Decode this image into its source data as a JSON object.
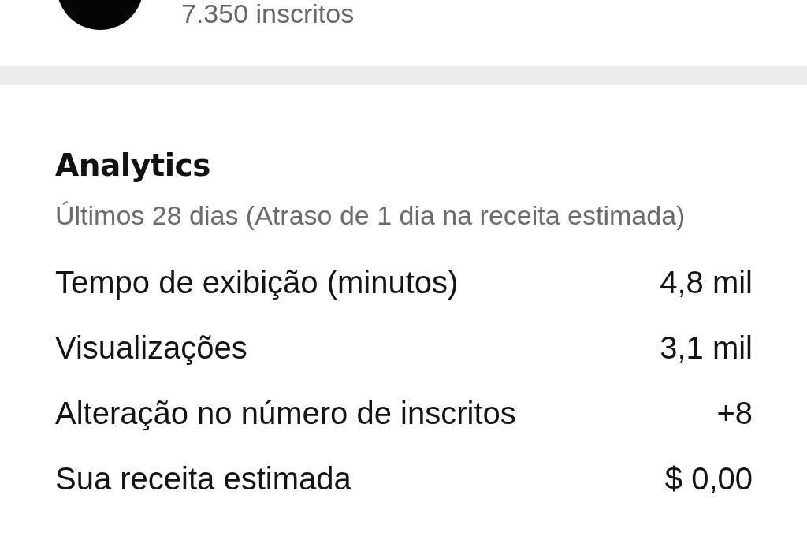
{
  "channel": {
    "subscribers": "7.350 inscritos"
  },
  "analytics": {
    "title": "Analytics",
    "subtitle": "Últimos 28 dias (Atraso de 1 dia na receita estimada)",
    "metrics": [
      {
        "label": "Tempo de exibição (minutos)",
        "value": "4,8 mil"
      },
      {
        "label": "Visualizações",
        "value": "3,1 mil"
      },
      {
        "label": "Alteração no número de inscritos",
        "value": "+8"
      },
      {
        "label": "Sua receita estimada",
        "value": "$ 0,00"
      }
    ]
  }
}
